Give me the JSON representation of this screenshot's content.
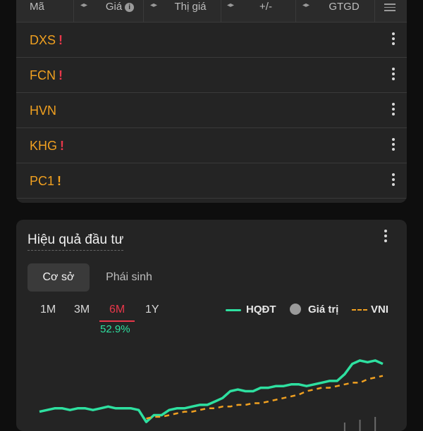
{
  "watchlist": {
    "headers": {
      "symbol": "Mã",
      "price": "Giá",
      "market_price": "Thị giá",
      "change": "+/-",
      "value": "GTGD"
    },
    "rows": [
      {
        "symbol": "DXS",
        "warn": "!",
        "warn_color": "#e8374a"
      },
      {
        "symbol": "FCN",
        "warn": "!",
        "warn_color": "#e8374a"
      },
      {
        "symbol": "HVN",
        "warn": "",
        "warn_color": ""
      },
      {
        "symbol": "KHG",
        "warn": "!",
        "warn_color": "#e8374a"
      },
      {
        "symbol": "PC1",
        "warn": "!",
        "warn_color": "#f0a020"
      }
    ]
  },
  "performance": {
    "title": "Hiệu quả đầu tư",
    "tabs": [
      "Cơ sở",
      "Phái sinh"
    ],
    "active_tab": "Cơ sở",
    "ranges": [
      "1M",
      "3M",
      "6M",
      "1Y"
    ],
    "active_range": "6M",
    "return_pct": "52.9%",
    "legend": {
      "hqdt": "HQĐT",
      "value": "Giá trị",
      "vni": "VNI"
    },
    "colors": {
      "hqdt": "#2ee0a0",
      "vni": "#f0a020",
      "accent_red": "#e8374a",
      "ticker": "#f0a020"
    }
  },
  "chart_data": {
    "type": "line",
    "series": [
      {
        "name": "HQĐT",
        "values": [
          0,
          0.5,
          1,
          1,
          0.5,
          1,
          1,
          0.5,
          1,
          1.5,
          1,
          1,
          1,
          0.5,
          -3,
          -1,
          -1,
          0.5,
          1,
          1,
          1.5,
          2,
          2,
          3,
          4,
          6,
          6.5,
          6,
          6,
          7,
          7,
          7.5,
          7.5,
          8,
          8,
          7.5,
          8,
          8.5,
          9,
          9,
          11,
          14,
          15,
          14.5,
          15,
          14
        ]
      },
      {
        "name": "VNI",
        "values": [
          null,
          null,
          null,
          null,
          null,
          null,
          null,
          null,
          null,
          null,
          null,
          null,
          null,
          null,
          -2,
          -1.5,
          -1.5,
          -1,
          -0.5,
          0,
          0,
          0.5,
          1,
          1,
          1.5,
          1.5,
          2,
          2,
          2.5,
          2.5,
          3,
          3.5,
          4,
          4.5,
          5,
          6,
          6.5,
          7,
          7,
          7.5,
          8,
          8.5,
          8.5,
          9.5,
          10,
          10.5
        ]
      }
    ],
    "bars": [
      0,
      0,
      0,
      0,
      0,
      0,
      0,
      0,
      0,
      0,
      0,
      0,
      0,
      0,
      0,
      0,
      0,
      0,
      0,
      0,
      0,
      0,
      0,
      0,
      0,
      0,
      0,
      0,
      0,
      0,
      0,
      0,
      0,
      0,
      0,
      0,
      0,
      0,
      0,
      0,
      3,
      0,
      4,
      0,
      5,
      0
    ],
    "ylim": [
      -4,
      16
    ]
  }
}
